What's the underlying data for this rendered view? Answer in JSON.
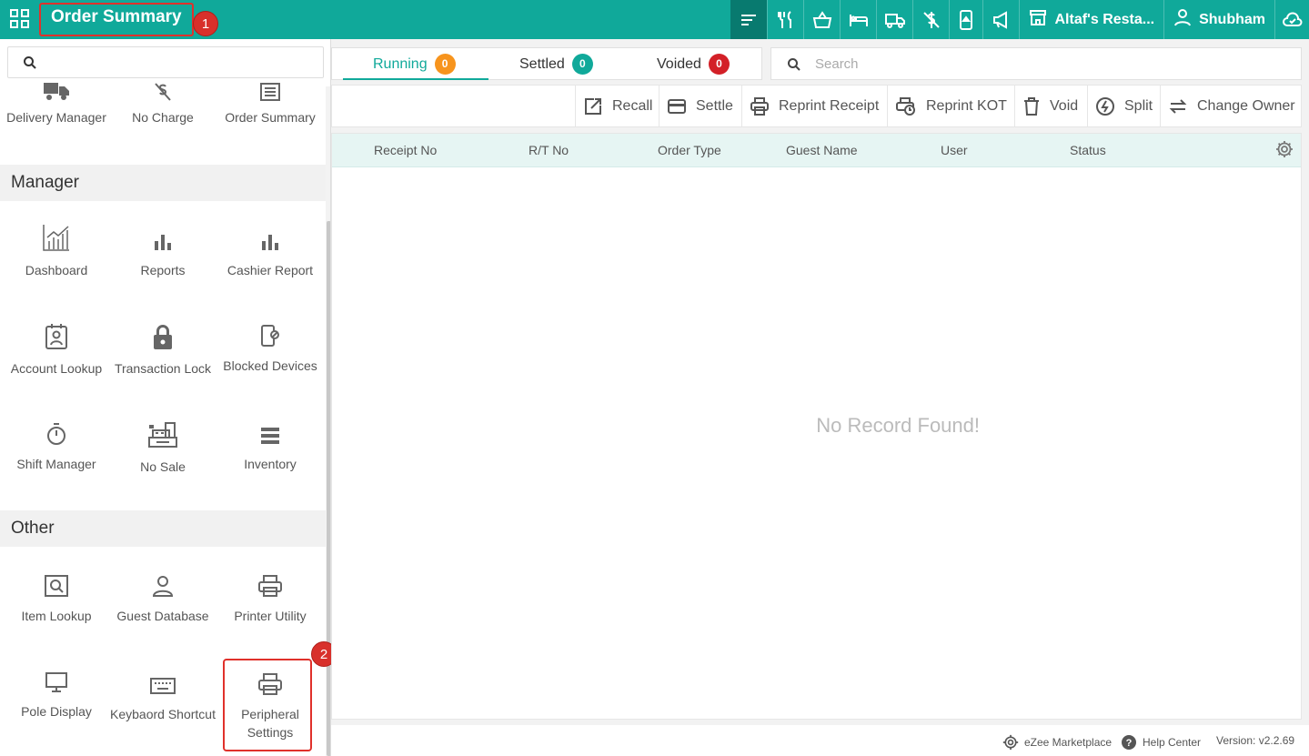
{
  "header": {
    "title": "Order Summary",
    "restaurant_label": "Altaf's Resta...",
    "user_label": "Shubham",
    "accent_color": "#10a99a",
    "icons": [
      "orders-list-icon",
      "dine-in-icon",
      "basket-icon",
      "room-service-icon",
      "delivery-icon",
      "no-charge-icon",
      "mobile-order-icon",
      "announcement-icon",
      "store-icon",
      "user-icon",
      "cloud-sync-icon"
    ]
  },
  "annotations": {
    "marker_1": "1",
    "marker_2": "2",
    "color": "#d8302b"
  },
  "sidebar": {
    "search_placeholder": "",
    "top_items": [
      {
        "label": "Delivery Manager",
        "icon": "delivery-truck-icon"
      },
      {
        "label": "No Charge",
        "icon": "no-charge-icon"
      },
      {
        "label": "Order Summary",
        "icon": "receipt-icon"
      }
    ],
    "manager_heading": "Manager",
    "manager_items": [
      {
        "label": "Dashboard",
        "icon": "dashboard-chart-icon"
      },
      {
        "label": "Reports",
        "icon": "bar-chart-icon"
      },
      {
        "label": "Cashier Report",
        "icon": "bar-chart-icon"
      },
      {
        "label": "Account Lookup",
        "icon": "id-badge-icon"
      },
      {
        "label": "Transaction Lock",
        "icon": "lock-icon"
      },
      {
        "label": "Blocked Devices",
        "icon": "blocked-device-icon"
      },
      {
        "label": "Shift Manager",
        "icon": "stopwatch-icon"
      },
      {
        "label": "No Sale",
        "icon": "cash-register-icon"
      },
      {
        "label": "Inventory",
        "icon": "inventory-list-icon"
      }
    ],
    "other_heading": "Other",
    "other_items": [
      {
        "label": "Item Lookup",
        "icon": "item-search-icon"
      },
      {
        "label": "Guest Database",
        "icon": "person-icon"
      },
      {
        "label": "Printer Utility",
        "icon": "printer-icon"
      },
      {
        "label": "Pole Display",
        "icon": "monitor-icon"
      },
      {
        "label": "Keybaord Shortcut",
        "icon": "keyboard-icon"
      },
      {
        "label": "Peripheral Settings",
        "icon": "printer-icon"
      }
    ]
  },
  "tabs": [
    {
      "label": "Running",
      "count": "0",
      "color": "#f7941d"
    },
    {
      "label": "Settled",
      "count": "0",
      "color": "#10a99a"
    },
    {
      "label": "Voided",
      "count": "0",
      "color": "#d32027"
    }
  ],
  "search": {
    "placeholder": "Search"
  },
  "actions": [
    {
      "label": "Recall",
      "icon": "recall-icon"
    },
    {
      "label": "Settle",
      "icon": "card-icon"
    },
    {
      "label": "Reprint Receipt",
      "icon": "printer-icon"
    },
    {
      "label": "Reprint KOT",
      "icon": "printer-clock-icon"
    },
    {
      "label": "Void",
      "icon": "trash-icon"
    },
    {
      "label": "Split",
      "icon": "split-icon"
    },
    {
      "label": "Change Owner",
      "icon": "swap-icon"
    }
  ],
  "table": {
    "columns": [
      "Receipt No",
      "R/T No",
      "Order Type",
      "Guest Name",
      "User",
      "Status"
    ],
    "empty_text": "No Record Found!"
  },
  "footer": {
    "marketplace": "eZee Marketplace",
    "help": "Help Center",
    "version": "Version: v2.2.69"
  }
}
